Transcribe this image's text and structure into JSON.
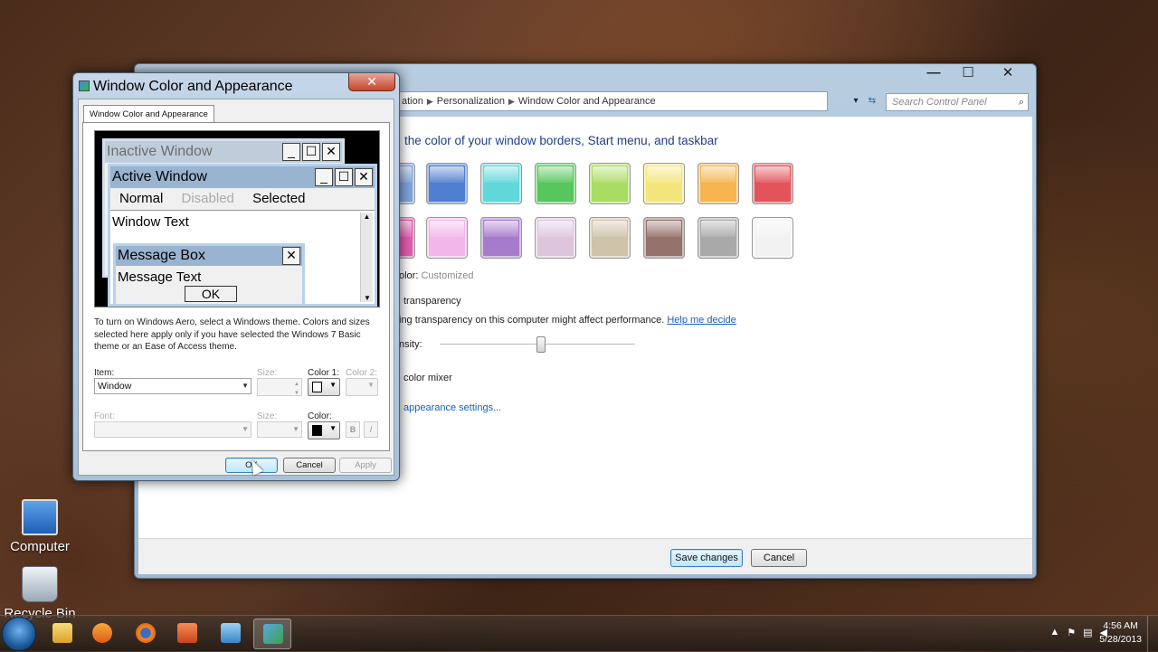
{
  "desktop": {
    "icons": [
      {
        "label": "Computer"
      },
      {
        "label": "Recycle Bin"
      }
    ]
  },
  "control_panel": {
    "breadcrumb": [
      "ation",
      "Personalization",
      "Window Color and Appearance"
    ],
    "search_placeholder": "Search Control Panel",
    "heading": "the color of your window borders, Start menu, and taskbar",
    "swatch_colors": [
      "#7fa6dc",
      "#4f7fd0",
      "#62d7da",
      "#57c65c",
      "#a9dc63",
      "#f4e57a",
      "#f6b550",
      "#e2545a",
      "#e55cb0",
      "#f3b6ea",
      "#a77bcc",
      "#ddc6dc",
      "#cfc3aa",
      "#94716a",
      "#a9a9a9",
      "#f2f2f2"
    ],
    "current_color_label": "olor:",
    "current_color_value": "Customized",
    "transparency_label": "transparency",
    "perf_note": "ing transparency on this computer might affect performance.",
    "help_link": "Help me decide",
    "intensity_label": "nsity:",
    "intensity_value": 0.5,
    "mixer_label": "color mixer",
    "advanced_link": "appearance settings...",
    "save_button": "Save changes",
    "cancel_button": "Cancel"
  },
  "dialog": {
    "title": "Window Color and Appearance",
    "tab": "Window Color and Appearance",
    "preview": {
      "inactive_title": "Inactive Window",
      "active_title": "Active Window",
      "menu_normal": "Normal",
      "menu_disabled": "Disabled",
      "menu_selected": "Selected",
      "window_text": "Window Text",
      "msgbox_title": "Message Box",
      "msgbox_text": "Message Text",
      "msgbox_ok": "OK"
    },
    "description": "To turn on Windows Aero, select a Windows theme.  Colors and sizes selected here apply only if you have selected the Windows 7 Basic theme or an Ease of Access theme.",
    "item_label": "Item:",
    "item_value": "Window",
    "size_label": "Size:",
    "color1_label": "Color 1:",
    "color2_label": "Color 2:",
    "font_label": "Font:",
    "font_size_label": "Size:",
    "font_color_label": "Color:",
    "bold_label": "B",
    "italic_label": "I",
    "ok_button": "OK",
    "cancel_button": "Cancel",
    "apply_button": "Apply"
  },
  "taskbar": {
    "time": "4:56 AM",
    "date": "5/28/2013"
  }
}
